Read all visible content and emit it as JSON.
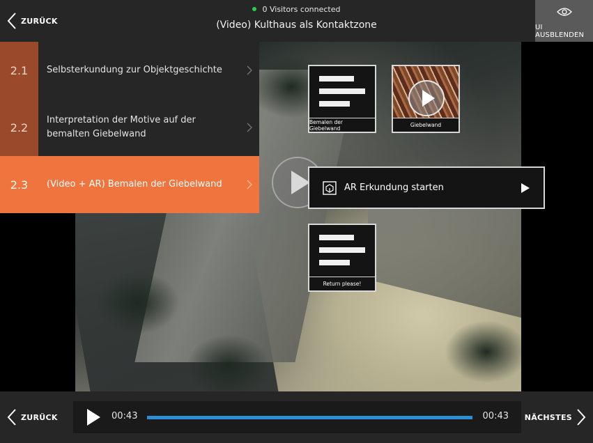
{
  "header": {
    "back_label": "ZURÜCK",
    "visitors": "0 Visitors connected",
    "title": "(Video) Kulthaus als Kontaktzone",
    "ui_hide_label": "UI AUSBLENDEN"
  },
  "chapters": [
    {
      "number": "2.1",
      "label": "Selbsterkundung zur Objektgeschichte"
    },
    {
      "number": "2.2",
      "label": "Interpretation der Motive auf der bemalten Giebelwand"
    },
    {
      "number": "2.3",
      "label": "(Video + AR) Bemalen der Giebelwand"
    }
  ],
  "tiles": [
    {
      "caption": "Bemalen der Giebelwand",
      "type": "text-icon"
    },
    {
      "caption": "Giebelwand",
      "type": "video"
    },
    {
      "caption": "Return please!",
      "type": "text-icon"
    }
  ],
  "ar_button": {
    "label": "AR Erkundung starten"
  },
  "footer": {
    "back_label": "ZURÜCK",
    "next_label": "NÄCHSTES",
    "current_time": "00:43",
    "duration": "00:43",
    "progress": 1.0
  },
  "colors": {
    "accent": "#f0743e",
    "chapter_number_bg": "#9a4a2b",
    "progress": "#2b8fd6",
    "status_online": "#29d04a"
  }
}
